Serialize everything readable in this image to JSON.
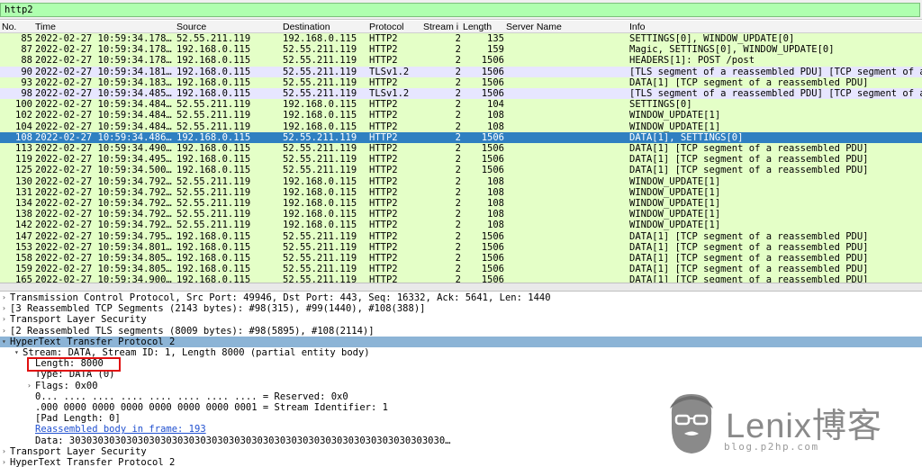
{
  "filter": {
    "value": "http2"
  },
  "columns": [
    "No.",
    "Time",
    "Source",
    "Destination",
    "Protocol",
    "Stream i",
    "Length",
    "Server Name",
    "Info"
  ],
  "packets": [
    {
      "no": "85",
      "time": "2022-02-27 10:59:34.178…",
      "src": "52.55.211.119",
      "dst": "192.168.0.115",
      "proto": "HTTP2",
      "stream": "2",
      "len": "135",
      "info": "SETTINGS[0], WINDOW_UPDATE[0]"
    },
    {
      "no": "87",
      "time": "2022-02-27 10:59:34.178…",
      "src": "192.168.0.115",
      "dst": "52.55.211.119",
      "proto": "HTTP2",
      "stream": "2",
      "len": "159",
      "info": "Magic, SETTINGS[0], WINDOW_UPDATE[0]"
    },
    {
      "no": "88",
      "time": "2022-02-27 10:59:34.178…",
      "src": "192.168.0.115",
      "dst": "52.55.211.119",
      "proto": "HTTP2",
      "stream": "2",
      "len": "1506",
      "info": "HEADERS[1]: POST /post"
    },
    {
      "no": "90",
      "time": "2022-02-27 10:59:34.181…",
      "src": "192.168.0.115",
      "dst": "52.55.211.119",
      "proto": "TLSv1.2",
      "stream": "2",
      "len": "1506",
      "info": "[TLS segment of a reassembled PDU] [TCP segment of a"
    },
    {
      "no": "93",
      "time": "2022-02-27 10:59:34.183…",
      "src": "192.168.0.115",
      "dst": "52.55.211.119",
      "proto": "HTTP2",
      "stream": "2",
      "len": "1506",
      "info": "DATA[1] [TCP segment of a reassembled PDU]"
    },
    {
      "no": "98",
      "time": "2022-02-27 10:59:34.485…",
      "src": "192.168.0.115",
      "dst": "52.55.211.119",
      "proto": "TLSv1.2",
      "stream": "2",
      "len": "1506",
      "info": "[TLS segment of a reassembled PDU] [TCP segment of a"
    },
    {
      "no": "100",
      "time": "2022-02-27 10:59:34.484…",
      "src": "52.55.211.119",
      "dst": "192.168.0.115",
      "proto": "HTTP2",
      "stream": "2",
      "len": "104",
      "info": "SETTINGS[0]"
    },
    {
      "no": "102",
      "time": "2022-02-27 10:59:34.484…",
      "src": "52.55.211.119",
      "dst": "192.168.0.115",
      "proto": "HTTP2",
      "stream": "2",
      "len": "108",
      "info": "WINDOW_UPDATE[1]"
    },
    {
      "no": "104",
      "time": "2022-02-27 10:59:34.484…",
      "src": "52.55.211.119",
      "dst": "192.168.0.115",
      "proto": "HTTP2",
      "stream": "2",
      "len": "108",
      "info": "WINDOW_UPDATE[1]"
    },
    {
      "no": "108",
      "time": "2022-02-27 10:59:34.486…",
      "src": "192.168.0.115",
      "dst": "52.55.211.119",
      "proto": "HTTP2",
      "stream": "2",
      "len": "1506",
      "info": "DATA[1], SETTINGS[0]"
    },
    {
      "no": "113",
      "time": "2022-02-27 10:59:34.490…",
      "src": "192.168.0.115",
      "dst": "52.55.211.119",
      "proto": "HTTP2",
      "stream": "2",
      "len": "1506",
      "info": "DATA[1] [TCP segment of a reassembled PDU]"
    },
    {
      "no": "119",
      "time": "2022-02-27 10:59:34.495…",
      "src": "192.168.0.115",
      "dst": "52.55.211.119",
      "proto": "HTTP2",
      "stream": "2",
      "len": "1506",
      "info": "DATA[1] [TCP segment of a reassembled PDU]"
    },
    {
      "no": "125",
      "time": "2022-02-27 10:59:34.500…",
      "src": "192.168.0.115",
      "dst": "52.55.211.119",
      "proto": "HTTP2",
      "stream": "2",
      "len": "1506",
      "info": "DATA[1] [TCP segment of a reassembled PDU]"
    },
    {
      "no": "130",
      "time": "2022-02-27 10:59:34.792…",
      "src": "52.55.211.119",
      "dst": "192.168.0.115",
      "proto": "HTTP2",
      "stream": "2",
      "len": "108",
      "info": "WINDOW_UPDATE[1]"
    },
    {
      "no": "131",
      "time": "2022-02-27 10:59:34.792…",
      "src": "52.55.211.119",
      "dst": "192.168.0.115",
      "proto": "HTTP2",
      "stream": "2",
      "len": "108",
      "info": "WINDOW_UPDATE[1]"
    },
    {
      "no": "134",
      "time": "2022-02-27 10:59:34.792…",
      "src": "52.55.211.119",
      "dst": "192.168.0.115",
      "proto": "HTTP2",
      "stream": "2",
      "len": "108",
      "info": "WINDOW_UPDATE[1]"
    },
    {
      "no": "138",
      "time": "2022-02-27 10:59:34.792…",
      "src": "52.55.211.119",
      "dst": "192.168.0.115",
      "proto": "HTTP2",
      "stream": "2",
      "len": "108",
      "info": "WINDOW_UPDATE[1]"
    },
    {
      "no": "142",
      "time": "2022-02-27 10:59:34.792…",
      "src": "52.55.211.119",
      "dst": "192.168.0.115",
      "proto": "HTTP2",
      "stream": "2",
      "len": "108",
      "info": "WINDOW_UPDATE[1]"
    },
    {
      "no": "147",
      "time": "2022-02-27 10:59:34.795…",
      "src": "192.168.0.115",
      "dst": "52.55.211.119",
      "proto": "HTTP2",
      "stream": "2",
      "len": "1506",
      "info": "DATA[1] [TCP segment of a reassembled PDU]"
    },
    {
      "no": "153",
      "time": "2022-02-27 10:59:34.801…",
      "src": "192.168.0.115",
      "dst": "52.55.211.119",
      "proto": "HTTP2",
      "stream": "2",
      "len": "1506",
      "info": "DATA[1] [TCP segment of a reassembled PDU]"
    },
    {
      "no": "158",
      "time": "2022-02-27 10:59:34.805…",
      "src": "192.168.0.115",
      "dst": "52.55.211.119",
      "proto": "HTTP2",
      "stream": "2",
      "len": "1506",
      "info": "DATA[1] [TCP segment of a reassembled PDU]"
    },
    {
      "no": "159",
      "time": "2022-02-27 10:59:34.805…",
      "src": "192.168.0.115",
      "dst": "52.55.211.119",
      "proto": "HTTP2",
      "stream": "2",
      "len": "1506",
      "info": "DATA[1] [TCP segment of a reassembled PDU]"
    },
    {
      "no": "165",
      "time": "2022-02-27 10:59:34.900…",
      "src": "192.168.0.115",
      "dst": "52.55.211.119",
      "proto": "HTTP2",
      "stream": "2",
      "len": "1506",
      "info": "DATA[1] [TCP segment of a reassembled PDU]"
    }
  ],
  "details": [
    {
      "level": 0,
      "arrow": "right",
      "text": "Transmission Control Protocol, Src Port: 49946, Dst Port: 443, Seq: 16332, Ack: 5641, Len: 1440"
    },
    {
      "level": 0,
      "arrow": "right",
      "text": "[3 Reassembled TCP Segments (2143 bytes): #98(315), #99(1440), #108(388)]"
    },
    {
      "level": 0,
      "arrow": "right",
      "text": "Transport Layer Security"
    },
    {
      "level": 0,
      "arrow": "right",
      "text": "[2 Reassembled TLS segments (8009 bytes): #98(5895), #108(2114)]"
    },
    {
      "level": 0,
      "arrow": "down",
      "text": "HyperText Transfer Protocol 2",
      "highlight": true
    },
    {
      "level": 1,
      "arrow": "down",
      "text": "Stream: DATA, Stream ID: 1, Length 8000 (partial entity body)"
    },
    {
      "level": 2,
      "arrow": "",
      "text": "Length: 8000"
    },
    {
      "level": 2,
      "arrow": "",
      "text": "Type: DATA (0)"
    },
    {
      "level": 2,
      "arrow": "right",
      "text": "Flags: 0x00"
    },
    {
      "level": 2,
      "arrow": "",
      "text": "0... .... .... .... .... .... .... .... = Reserved: 0x0"
    },
    {
      "level": 2,
      "arrow": "",
      "text": ".000 0000 0000 0000 0000 0000 0000 0001 = Stream Identifier: 1"
    },
    {
      "level": 2,
      "arrow": "",
      "text": "[Pad Length: 0]"
    },
    {
      "level": 2,
      "arrow": "",
      "text": "Reassembled body in frame: 193",
      "link": true
    },
    {
      "level": 2,
      "arrow": "",
      "text": "Data: 303030303030303030303030303030303030303030303030303030303030303030…"
    },
    {
      "level": 0,
      "arrow": "right",
      "text": "Transport Layer Security"
    },
    {
      "level": 0,
      "arrow": "right",
      "text": "HyperText Transfer Protocol 2"
    }
  ],
  "colors": {
    "http2_row": "#e4ffc7",
    "tls_row": "#e7e6ff",
    "selected_row": "#2f7fc1",
    "filter_ok": "#afffaf",
    "highlight": "#8cb4d6",
    "annotation_box": "#e01010"
  },
  "watermark": {
    "brand": "Lenix博客",
    "url": "blog.p2hp.com",
    "icon": "bearded-face-logo-icon"
  }
}
